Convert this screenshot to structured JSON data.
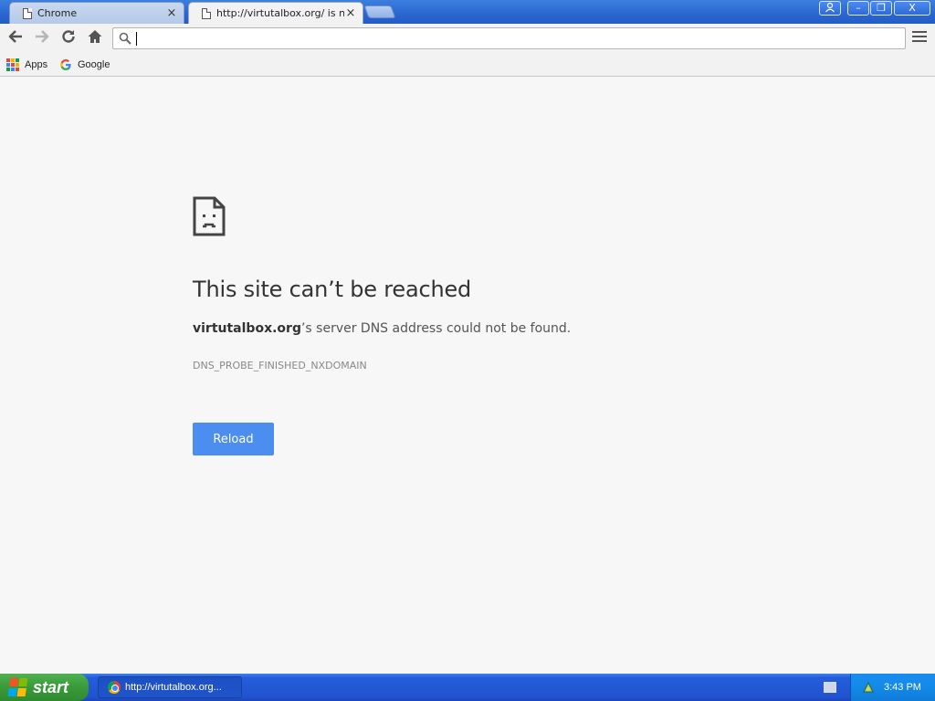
{
  "browser": {
    "tabs": [
      {
        "title": "Chrome",
        "close": "×"
      },
      {
        "title": "http://virtutalbox.org/ is not available",
        "close": "×"
      }
    ],
    "window_controls": {
      "minimize": "–",
      "maximize": "❐",
      "close": "X"
    },
    "omnibox": {
      "value": "",
      "placeholder": ""
    },
    "bookmarks": [
      {
        "label": "Apps"
      },
      {
        "label": "Google"
      }
    ]
  },
  "error_page": {
    "title": "This site can’t be reached",
    "domain": "virtutalbox.org",
    "message_rest": "’s server DNS address could not be found.",
    "error_code": "DNS_PROBE_FINISHED_NXDOMAIN",
    "reload_label": "Reload",
    "accent_color": "#4c8df0"
  },
  "taskbar": {
    "start_label": "start",
    "task_label": "http://virtutalbox.org...",
    "clock": "3:43 PM"
  }
}
